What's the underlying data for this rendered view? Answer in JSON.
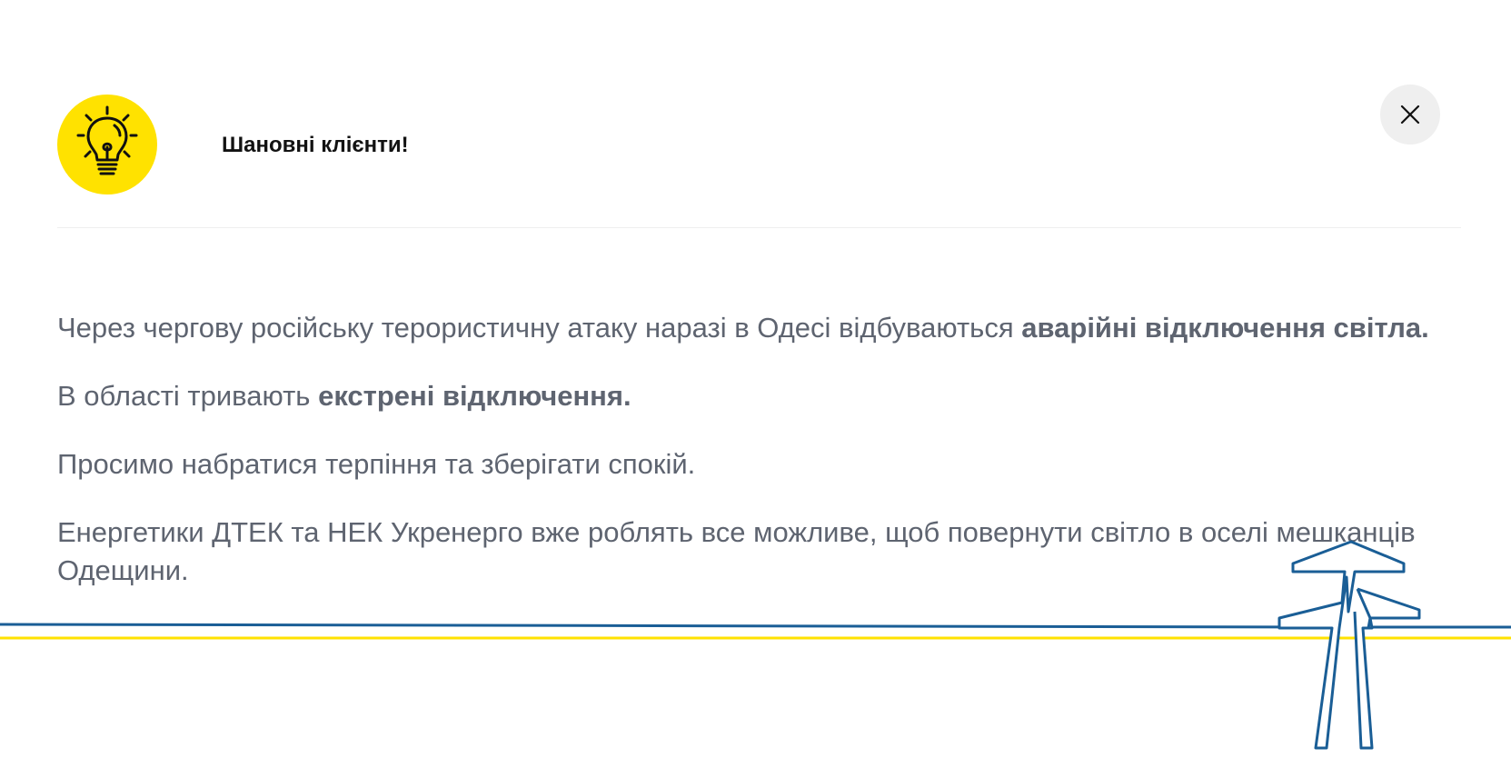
{
  "header": {
    "title": "Шановні клієнти!",
    "icon": "lightbulb-icon",
    "icon_bg_color": "#ffe200"
  },
  "close_button": {
    "icon": "close-icon"
  },
  "message": {
    "p1_regular": "Через чергову російську терористичну атаку наразі в Одесі відбуваються ",
    "p1_bold": "аварійні відключення світла.",
    "p2_regular": "В області тривають ",
    "p2_bold": "екстрені відключення.",
    "p3": "Просимо набратися терпіння та зберігати спокій.",
    "p4": "Енергетики ДТЕК та НЕК Укренерго вже роблять все можливе, щоб повернути світло в оселі мешканців Одещини."
  },
  "decoration": {
    "icon": "power-tower-icon",
    "line_blue": "#1a5e96",
    "line_yellow": "#ffe200"
  },
  "colors": {
    "text": "#5e6470",
    "title": "#121212",
    "accent_yellow": "#ffe200",
    "close_bg": "#efefef"
  }
}
